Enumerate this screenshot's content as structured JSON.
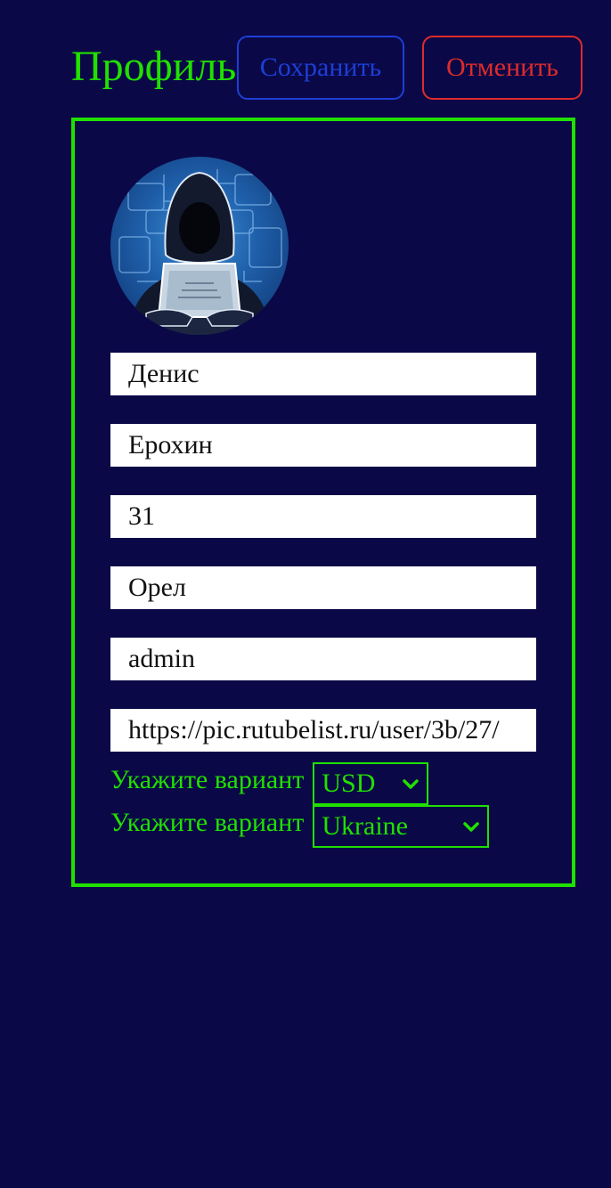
{
  "header": {
    "title": "Профиль",
    "save_label": "Сохранить",
    "cancel_label": "Отменить"
  },
  "form": {
    "first_name": "Денис",
    "last_name": "Ерохин",
    "age": "31",
    "city": "Орел",
    "role": "admin",
    "avatar_url": "https://pic.rutubelist.ru/user/3b/27/"
  },
  "selects": [
    {
      "label": "Укажите вариант",
      "value": "USD"
    },
    {
      "label": "Укажите вариант",
      "value": "Ukraine"
    }
  ],
  "colors": {
    "background": "#0a0847",
    "accent_green": "#21e000",
    "save_blue": "#1d3fd6",
    "cancel_red": "#de2b2b"
  },
  "icons": {
    "avatar": "hooded-hacker-avatar",
    "select_arrow": "chevron-down-icon"
  }
}
